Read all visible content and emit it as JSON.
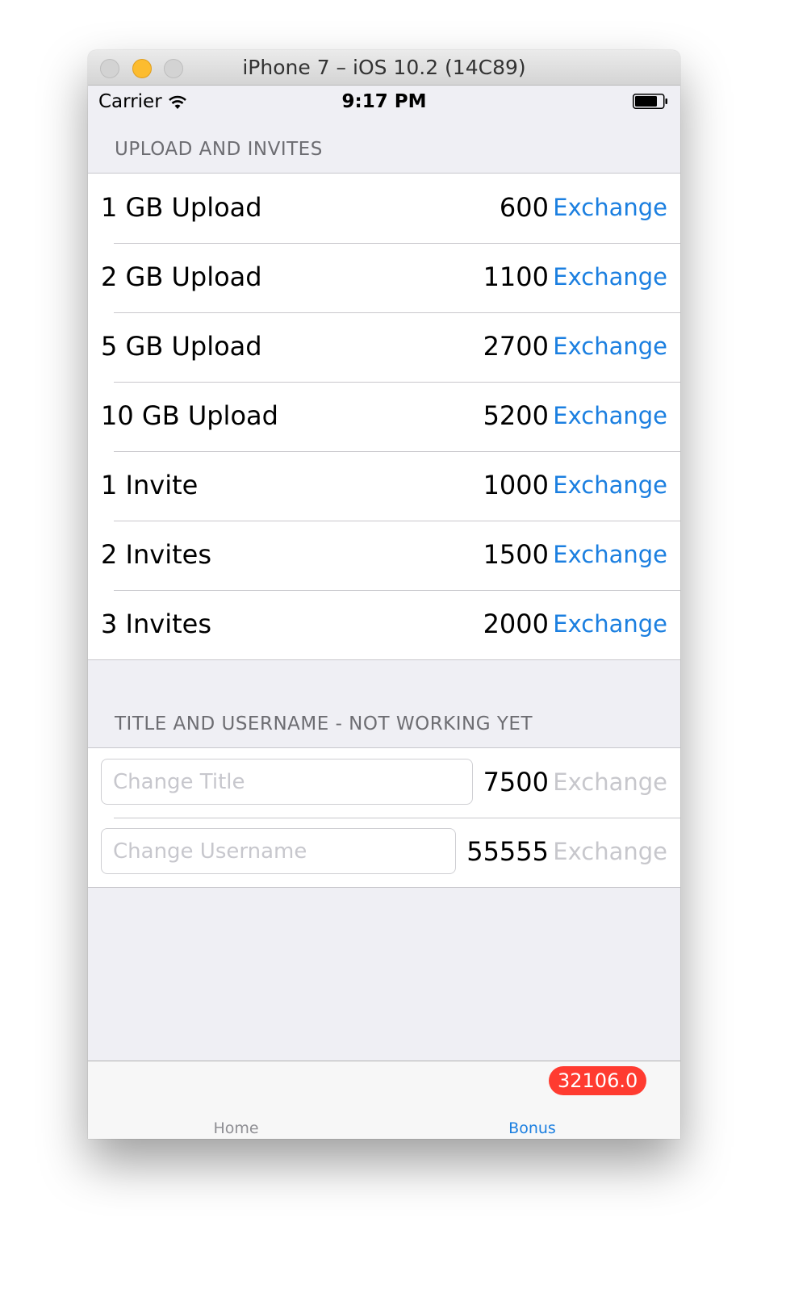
{
  "window": {
    "title": "iPhone 7 – iOS 10.2 (14C89)"
  },
  "status_bar": {
    "carrier": "Carrier",
    "time": "9:17 PM"
  },
  "sections": {
    "upload": {
      "header": "UPLOAD AND INVITES",
      "rows": [
        {
          "label": "1 GB Upload",
          "cost": "600",
          "action": "Exchange"
        },
        {
          "label": "2 GB Upload",
          "cost": "1100",
          "action": "Exchange"
        },
        {
          "label": "5 GB Upload",
          "cost": "2700",
          "action": "Exchange"
        },
        {
          "label": "10 GB Upload",
          "cost": "5200",
          "action": "Exchange"
        },
        {
          "label": "1 Invite",
          "cost": "1000",
          "action": "Exchange"
        },
        {
          "label": "2 Invites",
          "cost": "1500",
          "action": "Exchange"
        },
        {
          "label": "3 Invites",
          "cost": "2000",
          "action": "Exchange"
        }
      ]
    },
    "title_username": {
      "header": "TITLE AND USERNAME - NOT WORKING YET",
      "rows": [
        {
          "placeholder": "Change Title",
          "value": "",
          "cost": "7500",
          "action": "Exchange"
        },
        {
          "placeholder": "Change Username",
          "value": "",
          "cost": "55555",
          "action": "Exchange"
        }
      ]
    }
  },
  "tab_bar": {
    "tabs": [
      {
        "label": "Home",
        "selected": false
      },
      {
        "label": "Bonus",
        "selected": true
      }
    ],
    "badge": "32106.0"
  },
  "colors": {
    "accent": "#1b7fe0",
    "disabled": "#c7c7cc",
    "badge": "#ff3b30",
    "background": "#efeff4"
  }
}
